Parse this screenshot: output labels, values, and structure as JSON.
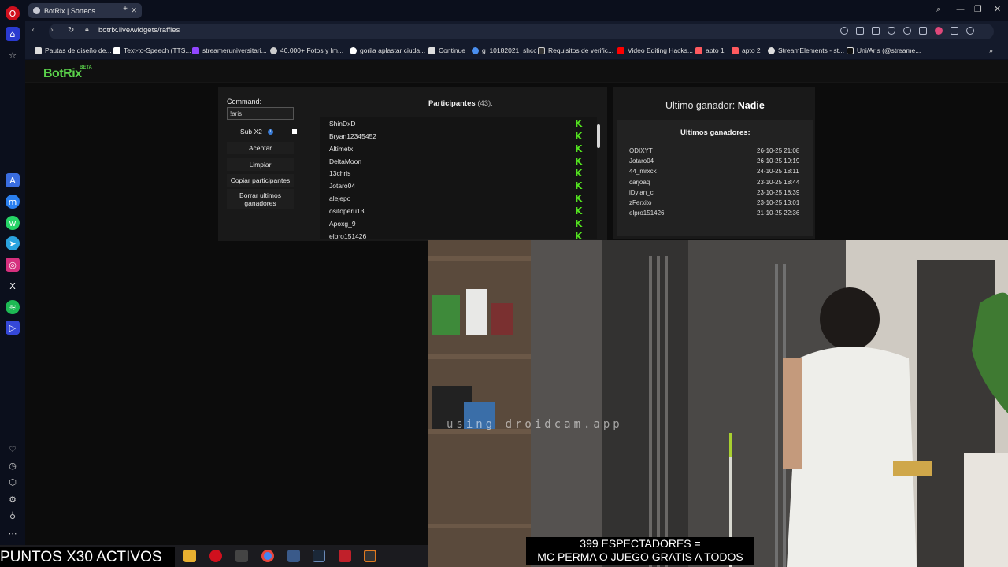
{
  "browser": {
    "tab_title": "BotRix | Sorteos",
    "tab_close": "✕",
    "new_tab": "+",
    "url": "botrix.live/widgets/raffles",
    "window_controls": [
      "⌕",
      "—",
      "❐",
      "✕"
    ]
  },
  "bookmarks": [
    {
      "label": "Pautas de diseño de...",
      "icon": "doc-icon",
      "color": "#e0e0e0"
    },
    {
      "label": "Text-to-Speech (TTS...",
      "icon": "tts-icon",
      "color": "#ffffff"
    },
    {
      "label": "streameruniversitari...",
      "icon": "twitch-icon",
      "color": "#9146ff"
    },
    {
      "label": "40.000+ Fotos y Im...",
      "icon": "pexels-icon",
      "color": "#e0e0e0"
    },
    {
      "label": "gorila aplastar ciuda...",
      "icon": "google-icon",
      "color": "#4285f4"
    },
    {
      "label": "Continue",
      "icon": "doc-icon",
      "color": "#e0e0e0"
    },
    {
      "label": "g_10182021_shcc",
      "icon": "drive-icon",
      "color": "#4a8ff0"
    },
    {
      "label": "Requisitos de verific...",
      "icon": "x-icon",
      "color": "#ffffff"
    },
    {
      "label": "Video Editing Hacks...",
      "icon": "youtube-icon",
      "color": "#ff0000"
    },
    {
      "label": "apto 1",
      "icon": "airbnb-icon",
      "color": "#ff5a5f"
    },
    {
      "label": "apto 2",
      "icon": "airbnb-icon",
      "color": "#ff5a5f"
    },
    {
      "label": "StreamElements - st...",
      "icon": "streamelements-icon",
      "color": "#e0e0e0"
    },
    {
      "label": "Uni/Aris (@streame...",
      "icon": "tiktok-icon",
      "color": "#ffffff"
    }
  ],
  "app": {
    "logo": "BotRix",
    "logo_badge": "BETA"
  },
  "raffle": {
    "command_label": "Command:",
    "command_value": "!aris",
    "sub_label": "Sub X2",
    "buttons": {
      "accept": "Aceptar",
      "clear": "Limpiar",
      "copy": "Copiar participantes",
      "delete_winners": "Borrar ultimos ganadores"
    },
    "participants_title": "Participantes",
    "participants_count": "(43):",
    "participants": [
      "ShinDxD",
      "Bryan12345452",
      "Altimetx",
      "DeltaMoon",
      "13chris",
      "Jotaro04",
      "alejepo",
      "ositoperu13",
      "Apoxg_9",
      "elpro151426"
    ],
    "platform_badge": "K",
    "winner_prefix": "Ultimo ganador:",
    "winner_name": "Nadie",
    "last_winners_title": "Ultimos ganadores:",
    "last_winners": [
      {
        "name": "ODIXYT",
        "date": "26-10-25 21:08"
      },
      {
        "name": "Jotaro04",
        "date": "26-10-25 19:19"
      },
      {
        "name": "44_mrxck",
        "date": "24-10-25 18:11"
      },
      {
        "name": "carjoaq",
        "date": "23-10-25 18:44"
      },
      {
        "name": "iDylan_c",
        "date": "23-10-25 18:39"
      },
      {
        "name": "zFerxito",
        "date": "23-10-25 13:01"
      },
      {
        "name": "elpro151426",
        "date": "21-10-25 22:36"
      }
    ]
  },
  "stream": {
    "watermark": "using droidcam.app",
    "overlay_line1": "399 ESPECTADORES =",
    "overlay_line2": "MC PERMA O JUEGO GRATIS A TODOS",
    "ticker": "PUNTOS X30 ACTIVOS"
  },
  "colors": {
    "accent": "#5ad14a",
    "kick_green": "#52e11f"
  }
}
